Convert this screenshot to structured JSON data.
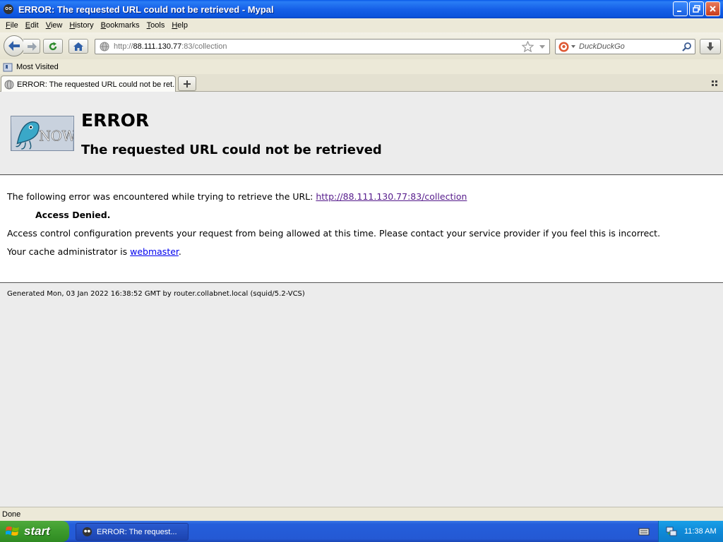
{
  "window": {
    "title": "ERROR: The requested URL could not be retrieved - Mypal"
  },
  "menu": {
    "items": [
      {
        "key": "F",
        "rest": "ile"
      },
      {
        "key": "E",
        "rest": "dit"
      },
      {
        "key": "V",
        "rest": "iew"
      },
      {
        "key": "H",
        "rest": "istory"
      },
      {
        "key": "B",
        "rest": "ookmarks"
      },
      {
        "key": "T",
        "rest": "ools"
      },
      {
        "key": "H",
        "rest": "elp"
      }
    ]
  },
  "toolbar": {
    "url_prefix": "http://",
    "url_host": "88.111.130.77",
    "url_suffix": ":83/collection",
    "search_placeholder": "DuckDuckGo"
  },
  "bookmarks": {
    "most_visited": "Most Visited"
  },
  "tabs": {
    "active_label": "ERROR: The requested URL could not be ret..."
  },
  "page": {
    "heading": "ERROR",
    "subheading": "The requested URL could not be retrieved",
    "intro_text": "The following error was encountered while trying to retrieve the URL: ",
    "intro_link": "http://88.111.130.77:83/collection",
    "denied": "Access Denied.",
    "explanation": "Access control configuration prevents your request from being allowed at this time. Please contact your service provider if you feel this is incorrect.",
    "admin_text": "Your cache administrator is ",
    "admin_link": "webmaster",
    "admin_end": ".",
    "footer": "Generated Mon, 03 Jan 2022 16:38:52 GMT by router.collabnet.local (squid/5.2-VCS)"
  },
  "status": {
    "text": "Done"
  },
  "taskbar": {
    "start_label": "start",
    "task_label": "ERROR: The request...",
    "clock": "11:38 AM"
  },
  "colors": {
    "titlebar": "#0b54dc",
    "visited_link": "#551a8b",
    "link": "#0000ee",
    "start_green": "#3c9a2c",
    "tray_blue": "#0f8ad8"
  },
  "icons": {
    "logo": "squid-now-logo",
    "nav": [
      "back-arrow-icon",
      "forward-arrow-icon",
      "reload-icon",
      "home-icon",
      "globe-icon",
      "star-icon",
      "duckduckgo-icon",
      "search-icon",
      "download-icon"
    ]
  }
}
